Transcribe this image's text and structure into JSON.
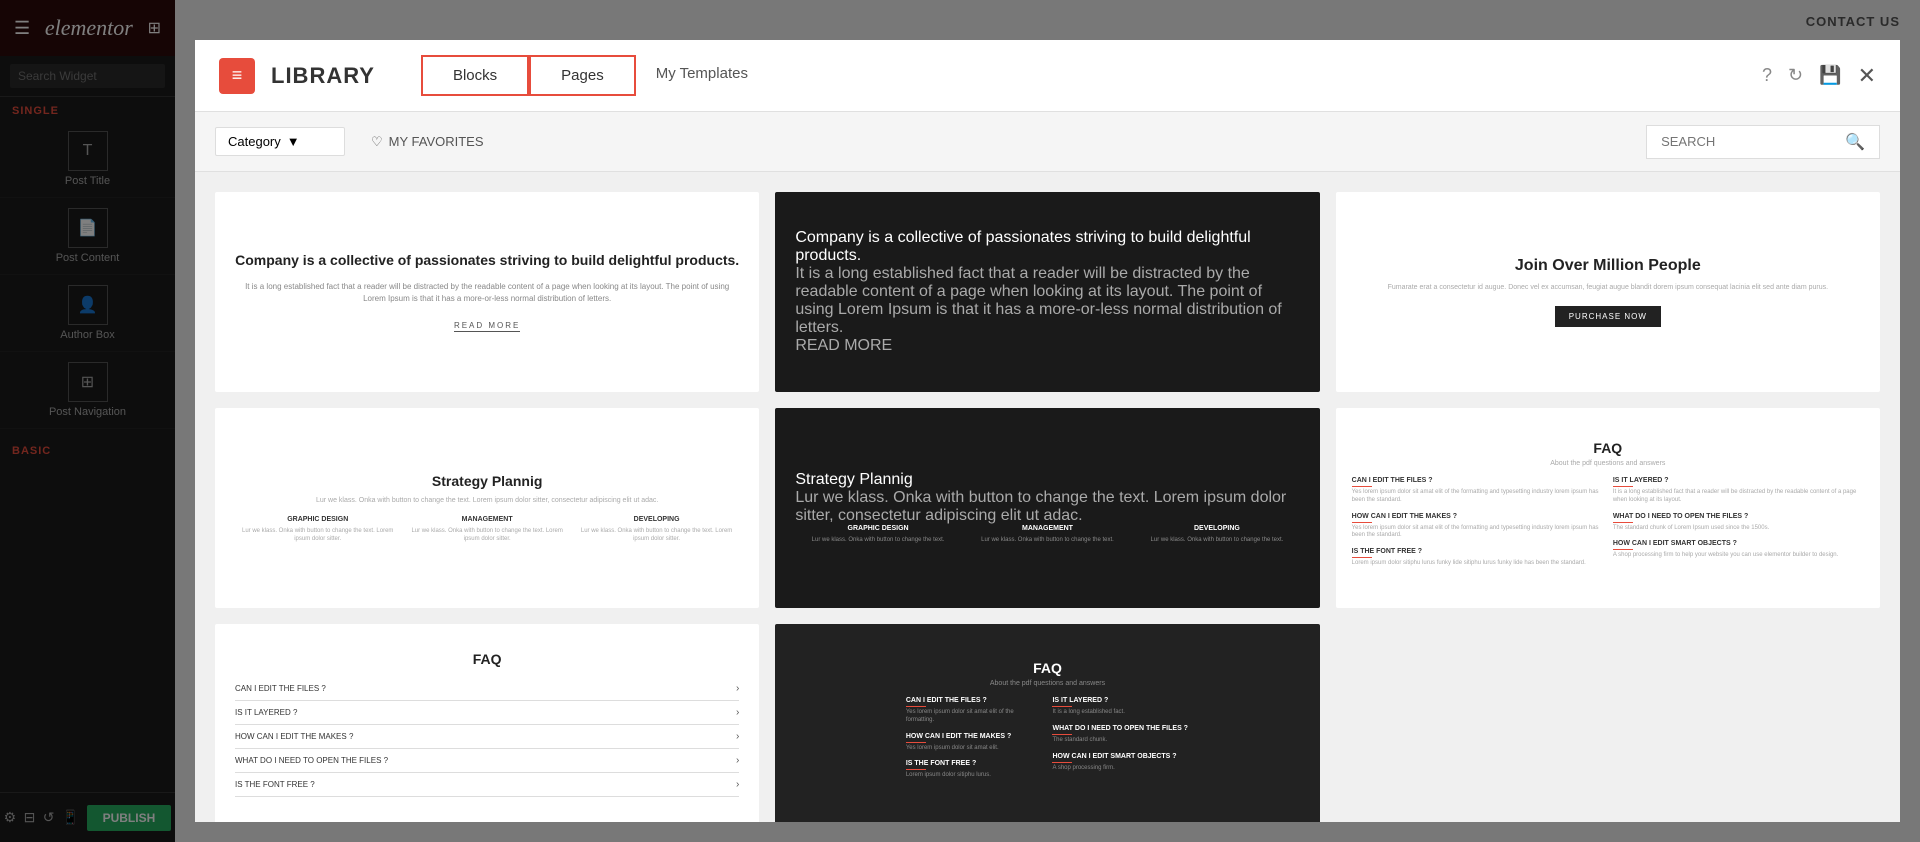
{
  "sidebar": {
    "logo_text": "elementor",
    "search_placeholder": "Search Widget",
    "section_single": "SINGLE",
    "section_basic": "BASIC",
    "items": [
      {
        "label": "Post Title",
        "icon": "T"
      },
      {
        "label": "Post Content",
        "icon": "📄"
      },
      {
        "label": "Author Box",
        "icon": "👤"
      },
      {
        "label": "Post Navigation",
        "icon": "⊞"
      }
    ],
    "publish_label": "PUBLISH"
  },
  "modal": {
    "logo_icon": "≡",
    "title": "LIBRARY",
    "tab_blocks": "Blocks",
    "tab_pages": "Pages",
    "tab_my_templates": "My Templates",
    "action_help": "?",
    "action_refresh": "↻",
    "action_save": "💾",
    "action_close": "✕",
    "toolbar": {
      "category_label": "Category",
      "favorites_label": "MY FAVORITES",
      "search_placeholder": "SEARCH"
    },
    "templates": [
      {
        "id": "company-white",
        "type": "company-white",
        "heading": "Company is a collective of passionates striving to build delightful products.",
        "body": "It is a long established fact that a reader will be distracted by the readable content of a page when looking at its layout. The point of using Lorem Ipsum is that it has a more-or-less normal distribution of letters.",
        "cta": "READ MORE"
      },
      {
        "id": "company-dark",
        "type": "company-dark",
        "heading": "Company is a collective of passionates striving to build delightful products.",
        "body": "It is a long established fact that a reader will be distracted by the readable content of a page when looking at its layout. The point of using Lorem Ipsum is that it has a more-or-less normal distribution of letters.",
        "cta": "READ MORE"
      },
      {
        "id": "join-million",
        "type": "join",
        "heading": "Join Over Million People",
        "body": "Fumarate erat a consectetur id augue. Donec vel ex accumsan, feugiat augue blandit dorem ipsum consequat lacinia elit sed ante diam purus.",
        "cta": "PURCHASE NOW"
      },
      {
        "id": "strategy-white",
        "type": "strategy-white",
        "heading": "Strategy Plannig",
        "body": "Lur we klass. Onka with button to change the text. Lorem ipsum dolor sitter, consectetur adipiscing elit ut adac.",
        "cols": [
          {
            "title": "GRAPHIC DESIGN",
            "text": "Lur we klass. Onka with button to change the text. Lorem ipsum dolor sitter."
          },
          {
            "title": "MANAGEMENT",
            "text": "Lur we klass. Onka with button to change the text. Lorem ipsum dolor sitter."
          },
          {
            "title": "DEVELOPING",
            "text": "Lur we klass. Onka with button to change the text. Lorem ipsum dolor sitter."
          }
        ]
      },
      {
        "id": "strategy-dark",
        "type": "strategy-dark",
        "heading": "Strategy Plannig",
        "body": "Lur we klass. Onka with button to change the text. Lorem ipsum dolor sitter, consectetur adipiscing elit ut adac.",
        "cols": [
          {
            "title": "GRAPHIC DESIGN",
            "text": "Lur we klass. Onka with button to change the text."
          },
          {
            "title": "MANAGEMENT",
            "text": "Lur we klass. Onka with button to change the text."
          },
          {
            "title": "DEVELOPING",
            "text": "Lur we klass. Onka with button to change the text."
          }
        ]
      },
      {
        "id": "faq-white2",
        "type": "faq-white2",
        "heading": "FAQ",
        "subtitle": "About the pdf questions and answers",
        "left_col": [
          {
            "q": "CAN I EDIT THE FILES ?",
            "a": "Yes lorem ipsum dolor sit amat elit of the formatting and typesetting industry lorem ipsum has been the standard."
          },
          {
            "q": "HOW CAN I EDIT THE MAKES ?",
            "a": "Yes lorem ipsum dolor sit amat elit of the formatting and typesetting industry lorem ipsum has been the standard."
          },
          {
            "q": "IS THE FONT FREE ?",
            "a": "Lorem ipsum dolor sitiphu lurus funky lide sitiphu lurus funky lide has been the standard."
          }
        ],
        "right_col": [
          {
            "q": "IS IT LAYERED ?",
            "a": "It is a long established fact that a reader will be distracted by the readable content of a page when looking at its layout."
          },
          {
            "q": "WHAT DO I NEED TO OPEN THE FILES ?",
            "a": "The standard chunk of Lorem Ipsum used since the 1500s."
          },
          {
            "q": "HOW CAN I EDIT SMART OBJECTS ?",
            "a": "A shop processing firm to help your website you can use elementor builder to design."
          }
        ]
      },
      {
        "id": "faq-accordion",
        "type": "faq-accordion",
        "heading": "FAQ",
        "items": [
          {
            "q": "CAN I EDIT THE FILES ?"
          },
          {
            "q": "IS IT LAYERED ?"
          },
          {
            "q": "HOW CAN I EDIT THE MAKES ?"
          },
          {
            "q": "WHAT DO I NEED TO OPEN THE FILES ?"
          },
          {
            "q": "IS THE FONT FREE ?"
          }
        ]
      },
      {
        "id": "faq-dark",
        "type": "faq-dark",
        "heading": "FAQ",
        "subtitle": "About the pdf questions and answers",
        "left_col": [
          {
            "q": "CAN I EDIT THE FILES ?",
            "a": "Yes lorem ipsum dolor sit amat elit of the formatting."
          },
          {
            "q": "HOW CAN I EDIT THE MAKES ?",
            "a": "Yes lorem ipsum dolor sit amat elit."
          },
          {
            "q": "IS THE FONT FREE ?",
            "a": "Lorem ipsum dolor sitiphu lurus."
          }
        ],
        "right_col": [
          {
            "q": "IS IT LAYERED ?",
            "a": "It is a long established fact."
          },
          {
            "q": "WHAT DO I NEED TO OPEN THE FILES ?",
            "a": "The standard chunk."
          },
          {
            "q": "HOW CAN I EDIT SMART OBJECTS ?",
            "a": "A shop processing firm."
          }
        ]
      }
    ]
  },
  "page": {
    "contact_us": "CONTACT US"
  }
}
